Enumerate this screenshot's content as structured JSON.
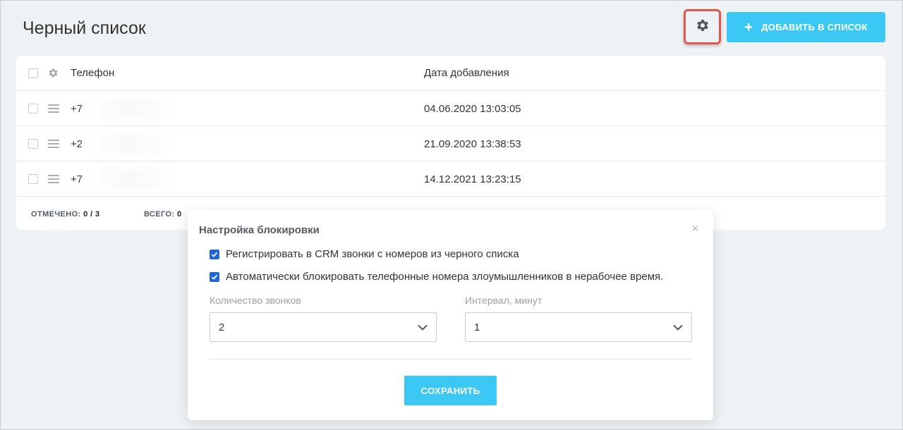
{
  "page": {
    "title": "Черный список"
  },
  "toolbar": {
    "settings_icon": "gear-icon",
    "add_label": "ДОБАВИТЬ В СПИСОК",
    "add_icon": "plus-icon"
  },
  "table": {
    "columns": {
      "phone": "Телефон",
      "date": "Дата добавления"
    },
    "rows": [
      {
        "phone": "+7",
        "date": "04.06.2020 13:03:05"
      },
      {
        "phone": "+2",
        "date": "21.09.2020 13:38:53"
      },
      {
        "phone": "+7",
        "date": "14.12.2021 13:23:15"
      }
    ],
    "footer": {
      "selected_label": "ОТМЕЧЕНО:",
      "selected_value": "0 / 3",
      "total_label": "ВСЕГО:",
      "total_value": "0"
    }
  },
  "modal": {
    "title": "Настройка блокировки",
    "close": "×",
    "options": [
      {
        "label": "Регистрировать в CRM звонки с номеров из черного списка",
        "checked": true
      },
      {
        "label": "Автоматически блокировать телефонные номера злоумышленников в нерабочее время.",
        "checked": true
      }
    ],
    "calls_label": "Количество звонков",
    "calls_value": "2",
    "interval_label": "Интервал, минут",
    "interval_value": "1",
    "save_label": "СОХРАНИТЬ"
  },
  "colors": {
    "accent": "#3bc8f5",
    "checkbox_checked": "#2067d8",
    "highlight": "#e2574c",
    "background": "#eef2f4"
  }
}
